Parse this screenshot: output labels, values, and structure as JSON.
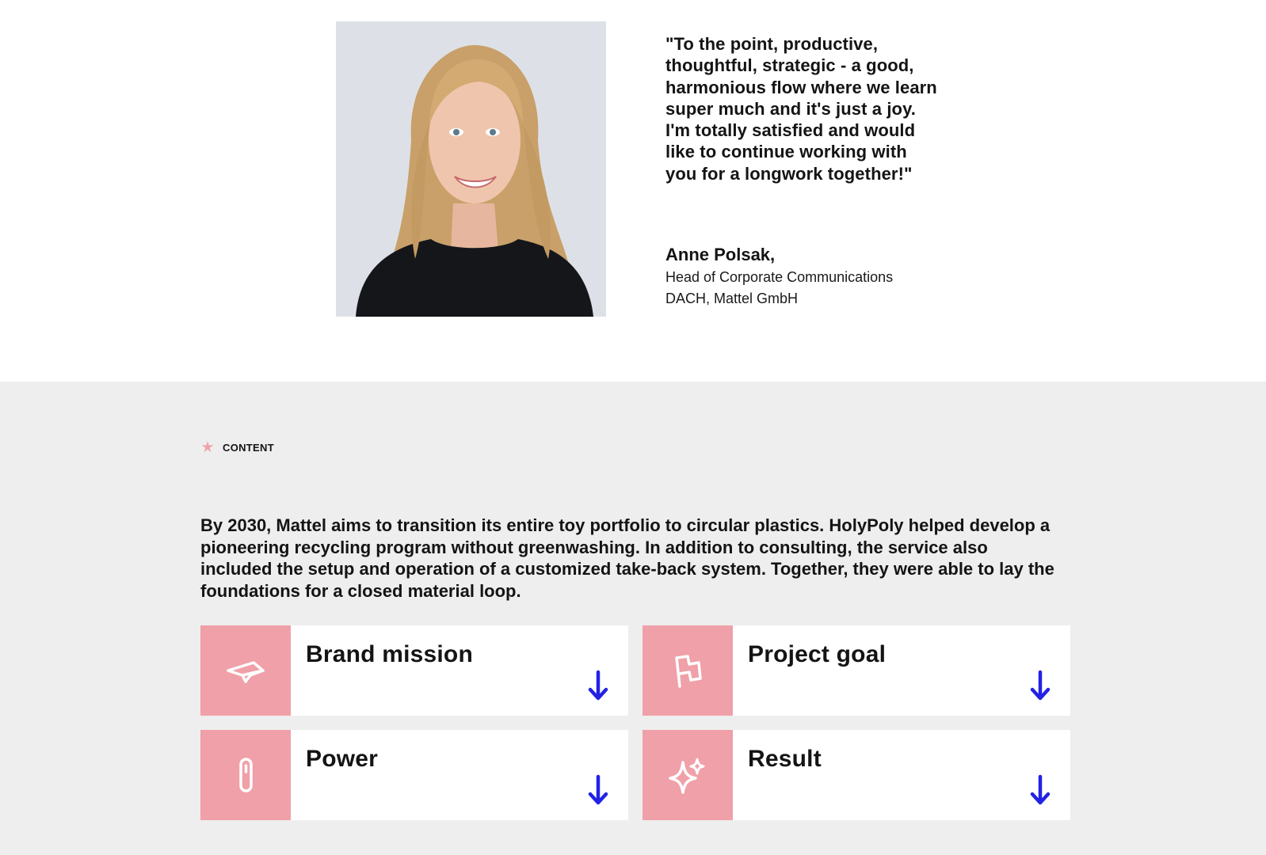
{
  "testimonial": {
    "quote": "\"To the point, productive,\nthoughtful, strategic - a good,\nharmonious flow where we learn\nsuper much and it's just a joy.\nI'm totally satisfied and would\nlike to continue working with\nyou for a longwork together!\"",
    "author_name": "Anne Polsak,",
    "author_role": "Head of Corporate Communications\nDACH, Mattel GmbH",
    "portrait_icon": "person-portrait"
  },
  "content": {
    "tag_label": "CONTENT",
    "tag_icon": "asterisk-icon",
    "intro": "By 2030, Mattel aims to transition its entire toy portfolio to circular plastics. HolyPoly helped develop a pioneering recycling program without greenwashing. In addition to consulting, the service also included the setup and operation of a customized take-back system. Together, they were able to lay the foundations for a closed material loop.",
    "cards": [
      {
        "title": "Brand mission",
        "icon": "paper-plane-icon"
      },
      {
        "title": "Project goal",
        "icon": "flag-icon"
      },
      {
        "title": "Power",
        "icon": "battery-icon"
      },
      {
        "title": "Result",
        "icon": "sparkle-icon"
      }
    ]
  },
  "colors": {
    "accent_pink": "#f0a0a8",
    "arrow_blue": "#2222e6",
    "section_bg": "#eeeeee",
    "card_bg": "#ffffff",
    "text": "#141414"
  }
}
